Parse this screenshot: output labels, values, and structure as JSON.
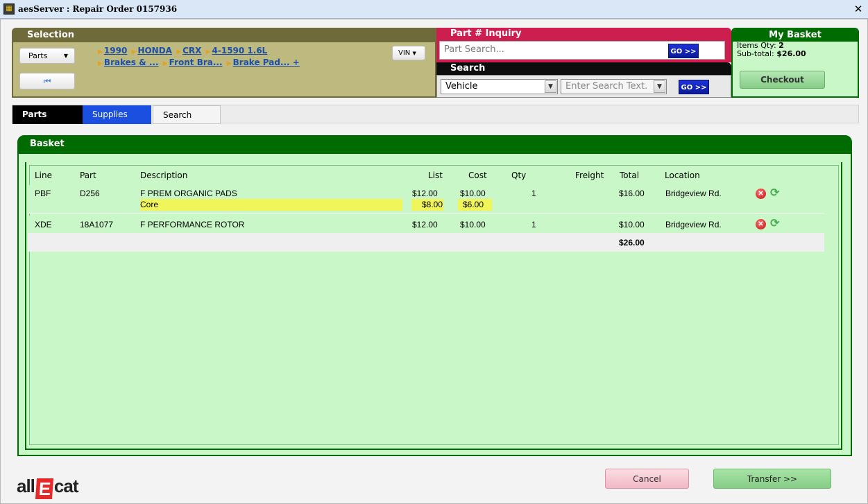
{
  "window": {
    "title": "aesServer : Repair Order 0157936",
    "close_glyph": "✕"
  },
  "selection": {
    "header": "Selection",
    "parts_button": "Parts",
    "vin_button": "VIN",
    "breadcrumbs_line1": [
      "1990",
      "HONDA",
      "CRX",
      "4-1590 1.6L"
    ],
    "breadcrumbs_line2": [
      "Brakes & ...",
      "Front Bra...",
      "Brake Pad... +"
    ]
  },
  "part_inquiry": {
    "header": "Part # Inquiry",
    "placeholder": "Part Search...",
    "go_label": "GO >>"
  },
  "search": {
    "header": "Search",
    "selected": "Vehicle",
    "placeholder": "Enter Search Text.",
    "go_label": "GO >>"
  },
  "my_basket": {
    "header": "My Basket",
    "items_label": "Items Qty:",
    "items_value": "2",
    "subtotal_label": "Sub-total:",
    "subtotal_value": "$26.00",
    "checkout_label": "Checkout"
  },
  "tabs": {
    "parts": "Parts",
    "supplies": "Supplies",
    "search": "Search",
    "active": "Parts"
  },
  "basket": {
    "header": "Basket",
    "columns": {
      "line": "Line",
      "part": "Part",
      "description": "Description",
      "list": "List",
      "cost": "Cost",
      "qty": "Qty",
      "freight": "Freight",
      "total": "Total",
      "location": "Location"
    },
    "rows": [
      {
        "line": "PBF",
        "part": "D256",
        "description": "F PREM ORGANIC PADS",
        "list": "$12.00",
        "cost": "$10.00",
        "qty": "1",
        "total": "$16.00",
        "location": "Bridgeview Rd.",
        "core_label": "Core",
        "core_list": "$8.00",
        "core_cost": "$6.00"
      },
      {
        "line": "XDE",
        "part": "18A1077",
        "description": "F PERFORMANCE ROTOR",
        "list": "$12.00",
        "cost": "$10.00",
        "qty": "1",
        "total": "$10.00",
        "location": "Bridgeview Rd."
      }
    ],
    "grand_total": "$26.00"
  },
  "footer": {
    "logo_left": "all",
    "logo_e": "E",
    "logo_right": "cat",
    "cancel_label": "Cancel",
    "transfer_label": "Transfer >>"
  },
  "colors": {
    "selection": "#beb97f",
    "inquiry": "#cd1f4f",
    "search": "#0d0d0d",
    "basket": "#006b00",
    "basket_bg": "#c9f7c8",
    "core_highlight": "#f0f55a"
  }
}
